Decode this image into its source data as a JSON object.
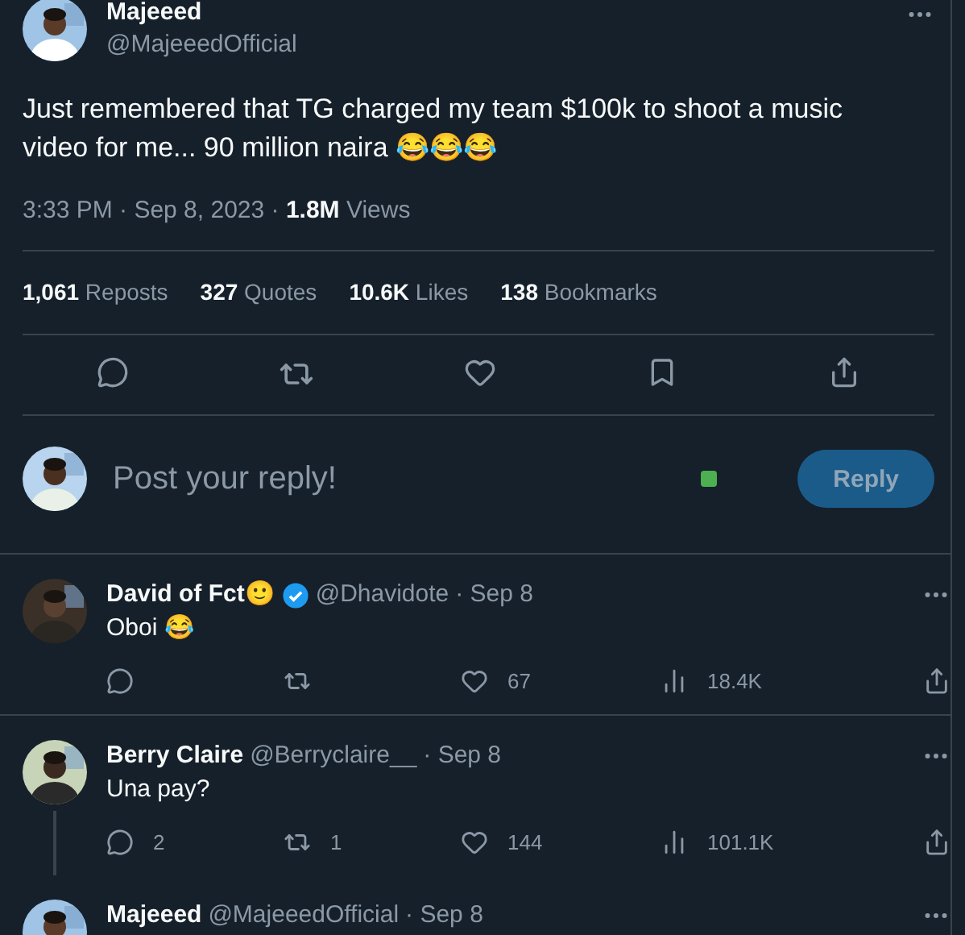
{
  "post": {
    "author": "Majeeed",
    "handle": "@MajeeedOfficial",
    "text": "Just remembered that TG charged my team $100k to shoot a music video for me... 90 million naira 😂😂😂",
    "meta": "3:33 PM · Sep 8, 2023 · **1.8M** Views"
  },
  "stats": [
    "**1,061** Reposts",
    "**327** Quotes",
    "**10.6K** Likes",
    "**138** Bookmarks"
  ],
  "composer": {
    "placeholder": "Post your reply!",
    "button": "Reply"
  },
  "replies": [
    {
      "author": "David of Fct🙂",
      "verified": true,
      "handle": "@Dhavidote",
      "date": "· Sep 8",
      "text": "Oboi 😂",
      "thread_line": false,
      "metrics": [
        {
          "kind": "reply"
        },
        {
          "kind": "repost"
        },
        {
          "kind": "like",
          "count": "67"
        },
        {
          "kind": "views",
          "count": "18.4K"
        },
        {
          "kind": "share"
        }
      ]
    },
    {
      "author": "Berry Claire",
      "verified": false,
      "handle": "@Berryclaire__",
      "date": "· Sep 8",
      "text": "Una pay?",
      "thread_line": true,
      "metrics": [
        {
          "kind": "reply",
          "count": "2"
        },
        {
          "kind": "repost",
          "count": "1"
        },
        {
          "kind": "like",
          "count": "144"
        },
        {
          "kind": "views",
          "count": "101.1K"
        },
        {
          "kind": "share"
        }
      ]
    },
    {
      "author": "Majeeed",
      "verified": false,
      "handle": "@MajeeedOfficial",
      "date": "· Sep 8",
      "thread_line": false
    }
  ]
}
